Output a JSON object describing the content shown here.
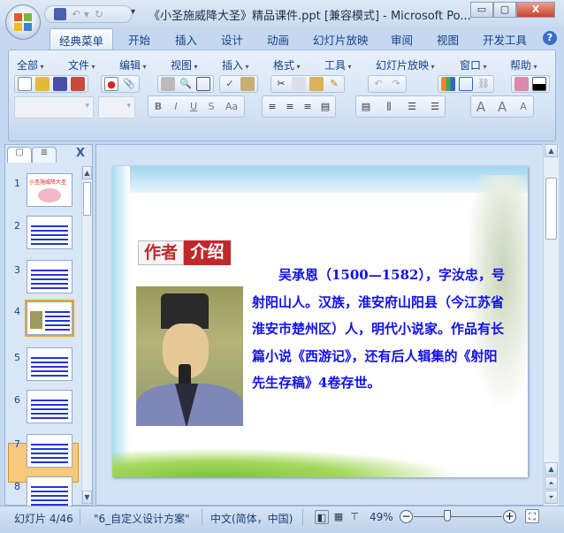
{
  "window": {
    "title": "《小圣施威降大圣》精品课件.ppt [兼容模式] - Microsoft Po...",
    "minimize": "▭",
    "restore": "▢",
    "close": "X"
  },
  "tabs": [
    "经典菜单",
    "开始",
    "插入",
    "设计",
    "动画",
    "幻灯片放映",
    "审阅",
    "视图",
    "开发工具"
  ],
  "help_icon": "?",
  "menus": [
    "全部",
    "文件",
    "编辑",
    "视图",
    "插入",
    "格式",
    "工具",
    "幻灯片放映",
    "窗口",
    "帮助"
  ],
  "format_buttons": {
    "bold": "B",
    "italic": "I",
    "underline": "U",
    "shadow": "S",
    "case": "Aa",
    "grow": "A",
    "shrink": "A"
  },
  "pane": {
    "close": "X"
  },
  "thumbnails": [
    1,
    2,
    3,
    4,
    5,
    6,
    7,
    8
  ],
  "thumb1_title": "小圣施威降大圣",
  "slide": {
    "header_a": "作者",
    "header_b": "介绍",
    "body": "吴承恩（1500—1582），字汝忠，号射阳山人。汉族，淮安府山阳县（今江苏省淮安市楚州区）人，明代小说家。作品有长篇小说《西游记》，还有后人辑集的《射阳先生存稿》4卷存世。"
  },
  "status": {
    "slide": "幻灯片 4/46",
    "theme": "\"6_自定义设计方案\"",
    "lang": "中文(简体，中国)",
    "zoom": "49%",
    "zoom_value": 49
  },
  "colors": {
    "accent_red": "#c0282b",
    "body_text": "#1010ee",
    "ribbon": "#d3e2f4"
  }
}
